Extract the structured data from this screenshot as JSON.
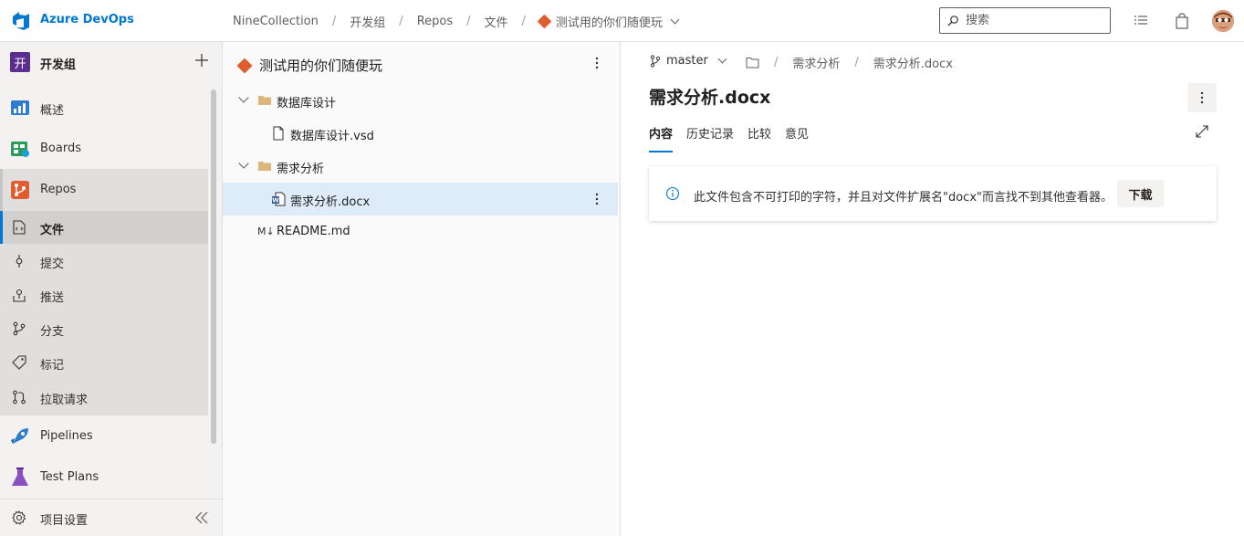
{
  "app": {
    "brand": "Azure DevOps"
  },
  "breadcrumb": [
    "NineCollection",
    "开发组",
    "Repos",
    "文件"
  ],
  "repo_name": "测试用的你们随便玩",
  "search": {
    "placeholder": "搜索"
  },
  "sidebar": {
    "org_initial": "开",
    "org_name": "开发组",
    "items": [
      {
        "label": "概述",
        "icon": "overview-icon"
      },
      {
        "label": "Boards",
        "icon": "boards-icon"
      },
      {
        "label": "Repos",
        "icon": "repos-icon"
      },
      {
        "label": "文件",
        "icon": "files-icon"
      },
      {
        "label": "提交",
        "icon": "commit-icon"
      },
      {
        "label": "推送",
        "icon": "push-icon"
      },
      {
        "label": "分支",
        "icon": "branch-icon"
      },
      {
        "label": "标记",
        "icon": "tag-icon"
      },
      {
        "label": "拉取请求",
        "icon": "pull-request-icon"
      },
      {
        "label": "Pipelines",
        "icon": "pipelines-icon"
      },
      {
        "label": "Test Plans",
        "icon": "test-plans-icon"
      }
    ],
    "settings_label": "项目设置"
  },
  "tree": {
    "title": "测试用的你们随便玩",
    "rows": [
      {
        "name": "数据库设计",
        "type": "folder"
      },
      {
        "name": "数据库设计.vsd",
        "type": "file"
      },
      {
        "name": "需求分析",
        "type": "folder"
      },
      {
        "name": "需求分析.docx",
        "type": "word-file",
        "selected": true
      },
      {
        "name": "README.md",
        "type": "markdown",
        "mark": "M↓"
      }
    ]
  },
  "content": {
    "branch": "master",
    "path": [
      "需求分析",
      "需求分析.docx"
    ],
    "file_title": "需求分析.docx",
    "tabs": [
      "内容",
      "历史记录",
      "比较",
      "意见"
    ],
    "active_tab": "内容",
    "message": "此文件包含不可打印的字符，并且对文件扩展名\"docx\"而言找不到其他查看器。",
    "download_label": "下载"
  },
  "colors": {
    "accent": "#0078d4",
    "git": "#e05d2f",
    "org_badge": "#5c2d91"
  }
}
